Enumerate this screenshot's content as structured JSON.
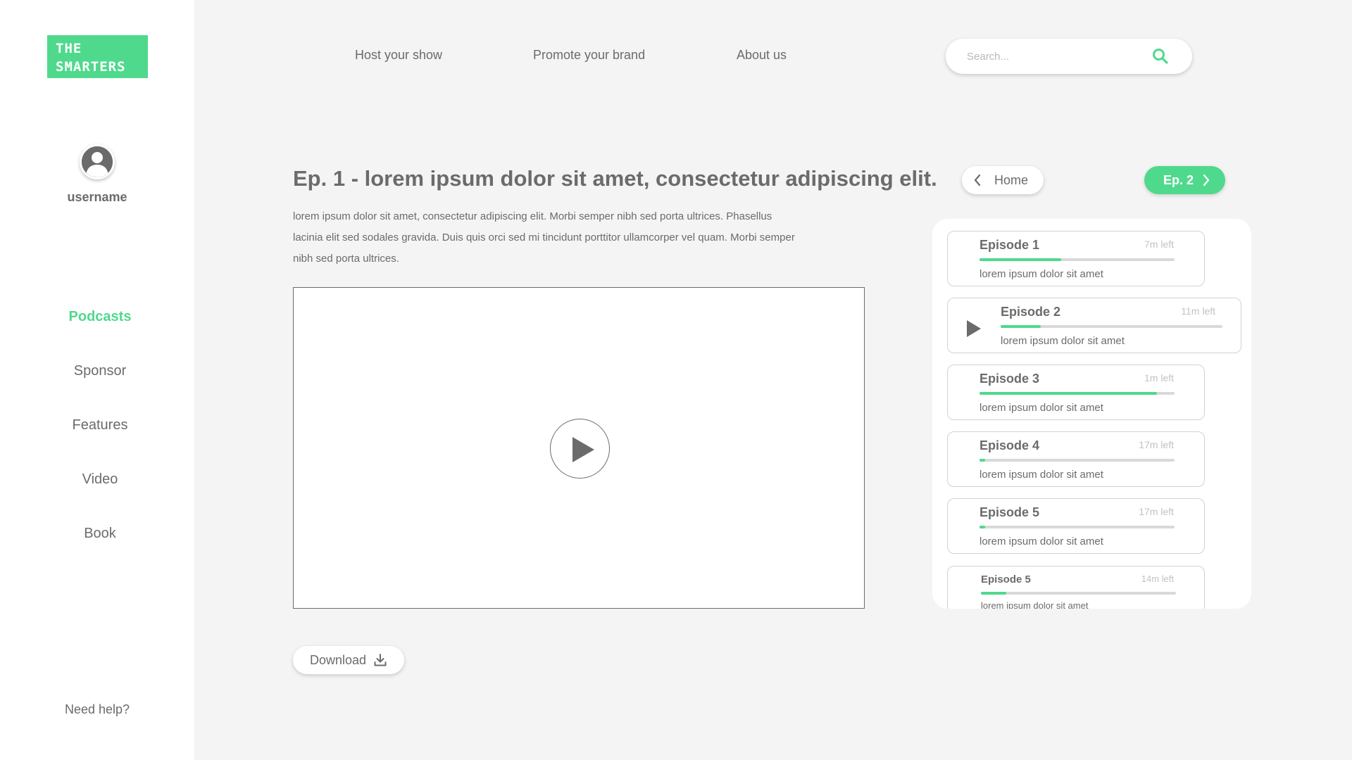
{
  "brand": {
    "line1": "THE",
    "line2": "SMARTERS",
    "accent": "#4fd98c"
  },
  "user": {
    "name": "username",
    "avatar_icon": "user-silhouette-icon"
  },
  "sidebar": {
    "items": [
      {
        "label": "Podcasts",
        "active": true
      },
      {
        "label": "Sponsor",
        "active": false
      },
      {
        "label": "Features",
        "active": false
      },
      {
        "label": "Video",
        "active": false
      },
      {
        "label": "Book",
        "active": false
      }
    ],
    "help": "Need help?"
  },
  "topnav": {
    "links": [
      "Host your show",
      "Promote your brand",
      "About us"
    ],
    "search_placeholder": "Search...",
    "search_icon": "search-icon"
  },
  "episode": {
    "title": "Ep. 1 - lorem ipsum dolor sit amet, consectetur adipiscing elit.",
    "description": "lorem ipsum dolor sit amet, consectetur adipiscing elit. Morbi semper nibh sed porta ultrices. Phasellus lacinia elit sed sodales gravida. Duis quis orci sed mi tincidunt porttitor ullamcorper vel quam. Morbi semper nibh sed porta ultrices.",
    "download_label": "Download",
    "play_icon": "play-icon"
  },
  "nav_buttons": {
    "home_label": "Home",
    "next_label": "Ep. 2"
  },
  "episodes": [
    {
      "name": "Episode 1",
      "time": "7m left",
      "progress": 0.42,
      "subtitle": "lorem ipsum dolor sit amet",
      "playing": false
    },
    {
      "name": "Episode 2",
      "time": "11m left",
      "progress": 0.18,
      "subtitle": "lorem ipsum dolor sit amet",
      "playing": true
    },
    {
      "name": "Episode 3",
      "time": "1m left",
      "progress": 0.91,
      "subtitle": "lorem ipsum dolor sit amet",
      "playing": false
    },
    {
      "name": "Episode 4",
      "time": "17m left",
      "progress": 0.03,
      "subtitle": "lorem ipsum dolor sit amet",
      "playing": false
    },
    {
      "name": "Episode 5",
      "time": "17m left",
      "progress": 0.03,
      "subtitle": "lorem ipsum dolor sit amet",
      "playing": false
    },
    {
      "name": "Episode 5",
      "time": "14m left",
      "progress": 0.13,
      "subtitle": "lorem ipsum dolor sit amet",
      "playing": false
    }
  ]
}
